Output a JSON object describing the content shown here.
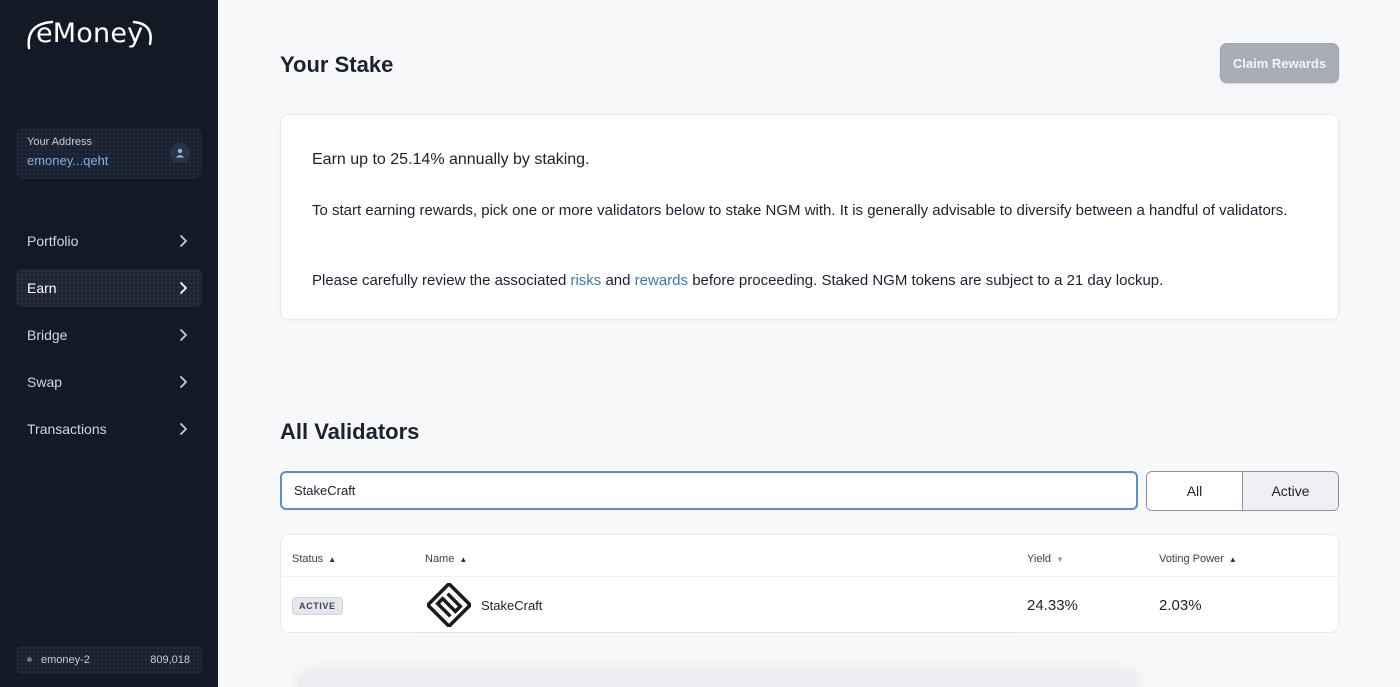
{
  "brand": {
    "name": "eMoney"
  },
  "sidebar": {
    "address": {
      "label": "Your Address",
      "value": "emoney...qeht"
    },
    "nav": [
      {
        "label": "Portfolio",
        "active": false
      },
      {
        "label": "Earn",
        "active": true
      },
      {
        "label": "Bridge",
        "active": false
      },
      {
        "label": "Swap",
        "active": false
      },
      {
        "label": "Transactions",
        "active": false
      }
    ],
    "chain": {
      "name": "emoney-2",
      "block_height": "809,018"
    }
  },
  "stake": {
    "title": "Your Stake",
    "claim_label": "Claim Rewards",
    "headline": "Earn up to 25.14% annually by staking.",
    "p1": "To start earning rewards, pick one or more validators below to stake NGM with. It is generally advisable to diversify between a handful of validators.",
    "p2_pre": "Please carefully review the associated ",
    "p2_link1": "risks",
    "p2_mid": " and ",
    "p2_link2": "rewards",
    "p2_post": " before proceeding. Staked NGM tokens are subject to a 21 day lockup."
  },
  "validators": {
    "title": "All Validators",
    "search_value": "StakeCraft",
    "filters": {
      "all": "All",
      "active": "Active",
      "selected": "Active"
    },
    "columns": {
      "status": "Status",
      "name": "Name",
      "yield": "Yield",
      "voting_power": "Voting Power"
    },
    "rows": [
      {
        "status": "ACTIVE",
        "name": "StakeCraft",
        "yield": "24.33%",
        "voting_power": "2.03%"
      }
    ]
  },
  "colors": {
    "sidebar_bg": "#141926",
    "accent": "#5b8fc6",
    "link": "#3a78b6",
    "address": "#7fb0e0"
  }
}
